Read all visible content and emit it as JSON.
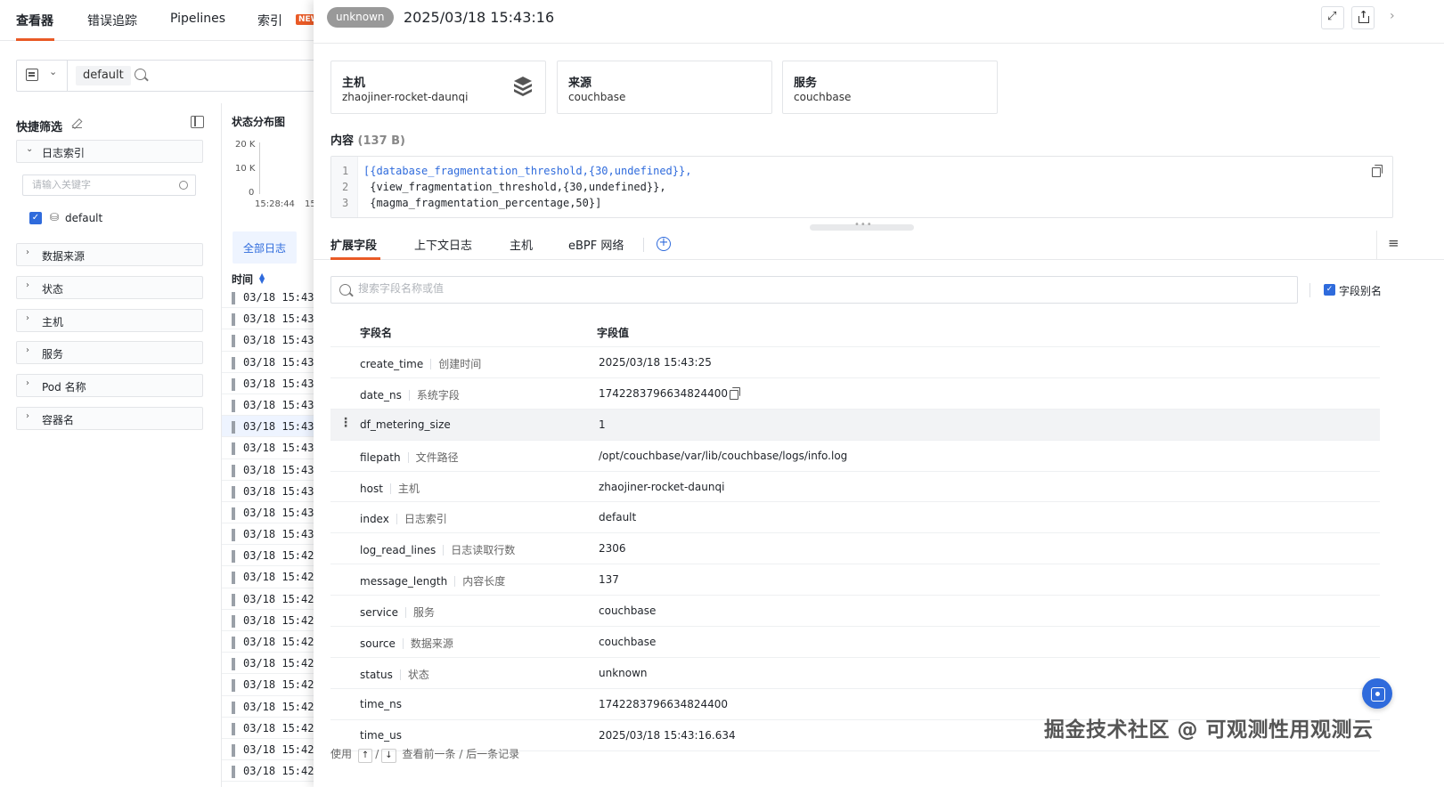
{
  "app": {
    "tabs": [
      {
        "label": "查看器"
      },
      {
        "label": "错误追踪"
      },
      {
        "label": "Pipelines"
      },
      {
        "label": "索引"
      }
    ],
    "new_badge": "NEW"
  },
  "query": {
    "chip": "default"
  },
  "quick_filter": {
    "title": "快捷筛选",
    "facets": [
      {
        "label": "日志索引"
      },
      {
        "label": "数据来源"
      },
      {
        "label": "状态"
      },
      {
        "label": "主机"
      },
      {
        "label": "服务"
      },
      {
        "label": "Pod 名称"
      },
      {
        "label": "容器名"
      }
    ],
    "search_placeholder": "请输入关键字",
    "index_option": "default"
  },
  "chart_data": {
    "type": "bar",
    "title": "状态分布图",
    "y_ticks": [
      "20 K",
      "10 K",
      "0"
    ],
    "x_ticks": [
      "15:28:44",
      "15"
    ]
  },
  "log_list": {
    "tab_label": "全部日志",
    "time_header": "时间",
    "rows": [
      "03/18 15:43",
      "03/18 15:43",
      "03/18 15:43",
      "03/18 15:43",
      "03/18 15:43",
      "03/18 15:43",
      "03/18 15:43",
      "03/18 15:43",
      "03/18 15:43",
      "03/18 15:43",
      "03/18 15:43",
      "03/18 15:43",
      "03/18 15:42",
      "03/18 15:42",
      "03/18 15:42",
      "03/18 15:42",
      "03/18 15:42",
      "03/18 15:42",
      "03/18 15:42",
      "03/18 15:42",
      "03/18 15:42",
      "03/18 15:42",
      "03/18 15:42"
    ]
  },
  "drawer": {
    "status": "unknown",
    "timestamp": "2025/03/18 15:43:16",
    "cards": [
      {
        "title": "主机",
        "value": "zhaojiner-rocket-daunqi"
      },
      {
        "title": "来源",
        "value": "couchbase"
      },
      {
        "title": "服务",
        "value": "couchbase"
      }
    ],
    "content_title": "内容",
    "content_size": "(137 B)",
    "code_lines": [
      {
        "num": "1",
        "text": "[{database_fragmentation_threshold,{30,undefined}},"
      },
      {
        "num": "2",
        "text": " {view_fragmentation_threshold,{30,undefined}},"
      },
      {
        "num": "3",
        "text": " {magma_fragmentation_percentage,50}]"
      }
    ],
    "tabs": [
      {
        "label": "扩展字段"
      },
      {
        "label": "上下文日志"
      },
      {
        "label": "主机"
      },
      {
        "label": "eBPF 网络"
      }
    ],
    "field_search_placeholder": "搜索字段名称或值",
    "alias_label": "字段别名",
    "table_headers": {
      "name": "字段名",
      "value": "字段值"
    },
    "fields": [
      {
        "name": "create_time",
        "alias": "创建时间",
        "value": "2025/03/18 15:43:25"
      },
      {
        "name": "date_ns",
        "alias": "系统字段",
        "value": "1742283796634824400"
      },
      {
        "name": "df_metering_size",
        "alias": "",
        "value": "1"
      },
      {
        "name": "filepath",
        "alias": "文件路径",
        "value": "/opt/couchbase/var/lib/couchbase/logs/info.log"
      },
      {
        "name": "host",
        "alias": "主机",
        "value": "zhaojiner-rocket-daunqi"
      },
      {
        "name": "index",
        "alias": "日志索引",
        "value": "default"
      },
      {
        "name": "log_read_lines",
        "alias": "日志读取行数",
        "value": "2306"
      },
      {
        "name": "message_length",
        "alias": "内容长度",
        "value": "137"
      },
      {
        "name": "service",
        "alias": "服务",
        "value": "couchbase"
      },
      {
        "name": "source",
        "alias": "数据来源",
        "value": "couchbase"
      },
      {
        "name": "status",
        "alias": "状态",
        "value": "unknown"
      },
      {
        "name": "time_ns",
        "alias": "",
        "value": "1742283796634824400"
      },
      {
        "name": "time_us",
        "alias": "",
        "value": "2025/03/18 15:43:16.634"
      }
    ],
    "footer": {
      "use": "使用",
      "key_up": "↑",
      "slash": "/",
      "key_down": "↓",
      "hint": "查看前一条 / 后一条记录"
    },
    "watermark": "掘金技术社区 @ 可观测性用观测云"
  }
}
